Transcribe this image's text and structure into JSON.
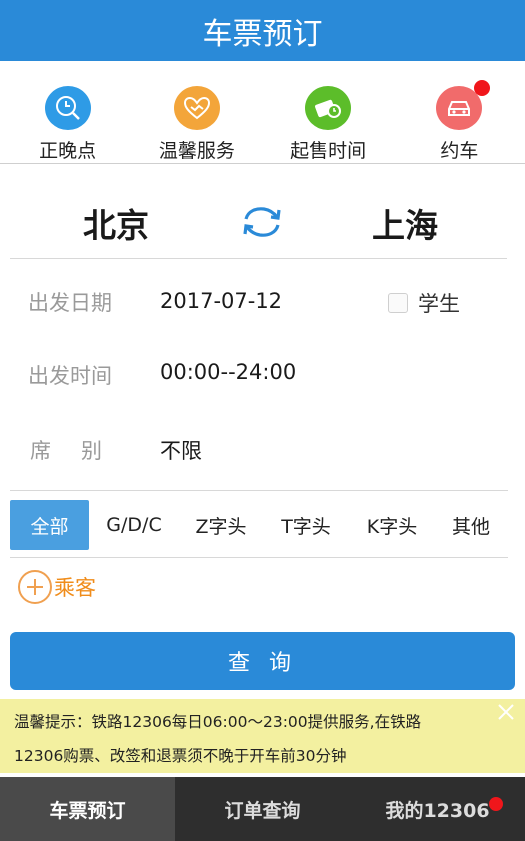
{
  "header": {
    "title": "车票预订"
  },
  "quick": [
    {
      "label": "正晚点",
      "icon": "clock-search-icon",
      "color": "#2e9be6"
    },
    {
      "label": "温馨服务",
      "icon": "handshake-heart-icon",
      "color": "#f3a53a"
    },
    {
      "label": "起售时间",
      "icon": "ticket-clock-icon",
      "color": "#5cbd2a"
    },
    {
      "label": "约车",
      "icon": "car-icon",
      "color": "#f16b6b",
      "badge": true
    }
  ],
  "stations": {
    "from": "北京",
    "to": "上海",
    "swap_icon": "swap-icon"
  },
  "form": {
    "date_label": "出发日期",
    "date_value": "2017-07-12",
    "student_label": "学生",
    "time_label": "出发时间",
    "time_value": "00:00--24:00",
    "seat_label": "席别",
    "seat_value": "不限"
  },
  "train_types": [
    "全部",
    "G/D/C",
    "Z字头",
    "T字头",
    "K字头",
    "其他"
  ],
  "passenger": {
    "label": "乘客"
  },
  "query_button": "查 询",
  "notice": {
    "line1": "温馨提示：铁路12306每日06:00～23:00提供服务,在铁路",
    "line2": "12306购票、改签和退票须不晚于开车前30分钟"
  },
  "nav": [
    {
      "label": "车票预订"
    },
    {
      "label": "订单查询"
    },
    {
      "label": "我的12306"
    }
  ],
  "colors": {
    "primary": "#2a8ad8",
    "accent": "#f08c1a",
    "notice_bg": "#f3f0a0",
    "badge": "#f0161b"
  }
}
